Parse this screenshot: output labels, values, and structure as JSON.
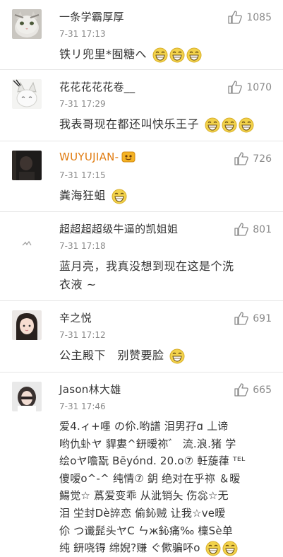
{
  "comments": [
    {
      "name": "一条学霸厚厚",
      "time": "7-31 17:13",
      "likes": "1085",
      "text": "铁リ兜里*囿糖へ",
      "emoji_count": 3,
      "avatar_icon": "cat-avatar"
    },
    {
      "name": "花花花花花卷__",
      "time": "7-31 17:29",
      "likes": "1070",
      "text": "我表哥现在都还叫快乐王子",
      "emoji_count": 3,
      "avatar_icon": "white-cat-avatar"
    },
    {
      "name": "WUYUJIAN-",
      "time": "7-31 17:15",
      "likes": "726",
      "text": "粪海狂蛆",
      "emoji_count": 1,
      "avatar_icon": "dark-photo-avatar",
      "name_color": "#e07b10"
    },
    {
      "name": "超超超超级牛逼的凯姐姐",
      "time": "7-31 17:18",
      "likes": "801",
      "text_lines": [
        "蓝月亮，我真没想到现在这是个洗",
        "衣液 ~"
      ],
      "emoji_count": 0,
      "avatar_icon": "white-avatar"
    },
    {
      "name": "辛之悦",
      "time": "7-31 17:12",
      "likes": "691",
      "text": "公主殿下　别赞要脸",
      "emoji_count": 1,
      "avatar_icon": "girl-avatar"
    },
    {
      "name": "Jason林大雄",
      "time": "7-31 17:46",
      "likes": "665",
      "text_lines": [
        "爱4.ィ+嚜 の伱.哟譜 泪男孖ɑ 丄谛",
        "哟仇虲ヤ 貋婁^鈃暧祢゛ 流.浪.猪 学",
        "绘oヤ噡翫 Bēyónd. 20.o⑦ 軠蔙葎 ᵀᴱᴸ",
        "傻嗳o^-^ 纯情⑦ 鈅 绝对在乎祢 ＆暧",
        "鰑觉☆ 蔿爱变乖 从泚销夨 伤惢☆无",
        "泪 坣封Dè誶恋 偷鈊贼 让我☆ve暧",
        "伱 つ谶髭头ヤC ㄣж鈊痛‰ 檁Sè单",
        "纯 鈃哓锝 绵婗?赚 ぐ僛骗吥o"
      ],
      "emoji_count": 2,
      "avatar_icon": "photo-avatar"
    }
  ],
  "colors": {
    "text": "#333333",
    "meta": "#8a8a8a",
    "divider": "#e6e6e6",
    "emoji": "#f2d24b"
  },
  "icons": {
    "like": "thumbs-up-icon",
    "emoji": "grin-emoji-icon",
    "badge": "vip-badge-icon"
  }
}
